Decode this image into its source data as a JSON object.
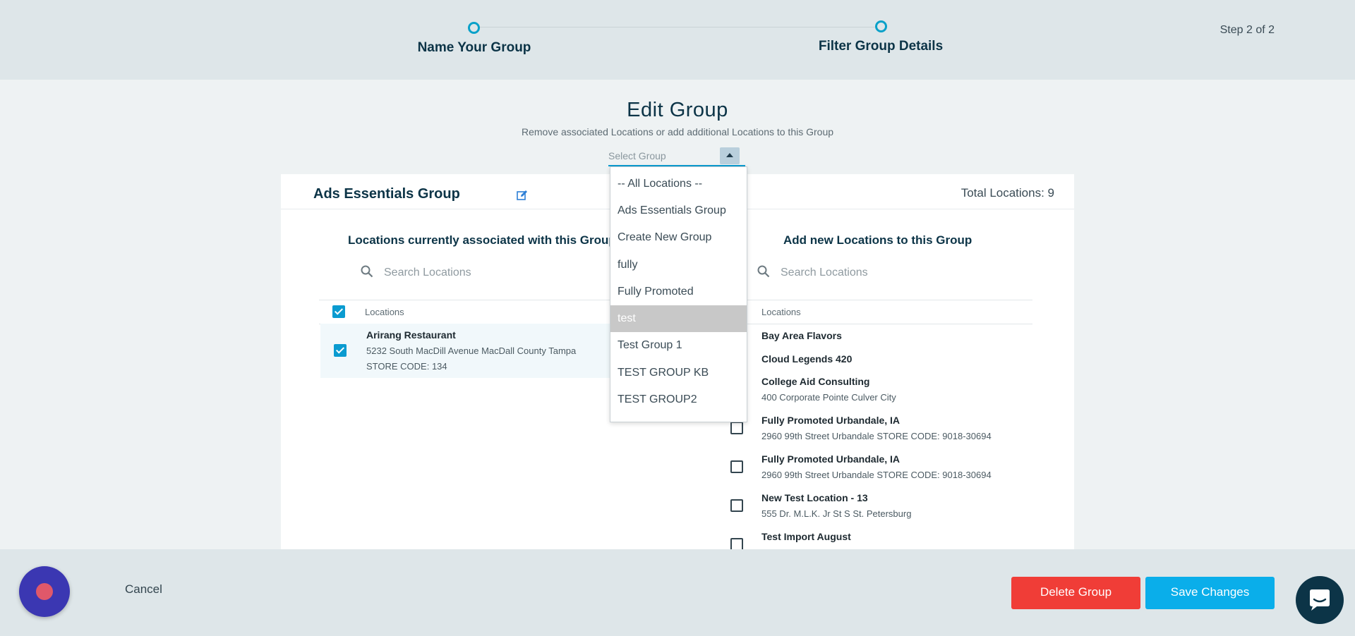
{
  "stepper": {
    "step1": "Name Your Group",
    "step2": "Filter Group Details",
    "counter": "Step 2 of 2"
  },
  "header": {
    "title": "Edit Group",
    "subtitle": "Remove associated Locations or add additional Locations to this Group"
  },
  "select": {
    "placeholder": "Select Group",
    "options": [
      "-- All Locations --",
      "Ads Essentials Group",
      "Create New Group",
      "fully",
      "Fully Promoted",
      "test",
      "Test Group 1",
      "TEST GROUP KB",
      "TEST GROUP2"
    ],
    "highlighted": "test"
  },
  "card": {
    "group_name": "Ads Essentials Group",
    "total_locations": "Total Locations: 9",
    "left": {
      "title": "Locations currently associated with this Group",
      "search_placeholder": "Search Locations",
      "column": "Locations",
      "rows": [
        {
          "name": "Arirang Restaurant",
          "address": "5232 South MacDill Avenue MacDall County Tampa",
          "store_code": "STORE CODE: 134",
          "checked": true
        }
      ]
    },
    "right": {
      "title": "Add new Locations to this Group",
      "search_placeholder": "Search Locations",
      "column": "Locations",
      "rows": [
        {
          "name": "Bay Area Flavors",
          "address": ""
        },
        {
          "name": "Cloud Legends 420",
          "address": ""
        },
        {
          "name": "College Aid Consulting",
          "address": "400 Corporate Pointe Culver City"
        },
        {
          "name": "Fully Promoted Urbandale, IA",
          "address": "2960 99th Street Urbandale STORE CODE: 9018-30694"
        },
        {
          "name": "Fully Promoted Urbandale, IA",
          "address": "2960 99th Street Urbandale STORE CODE: 9018-30694"
        },
        {
          "name": "New Test Location - 13",
          "address": "555 Dr. M.L.K. Jr St S St. Petersburg"
        },
        {
          "name": "Test Import August",
          "address": ""
        }
      ]
    }
  },
  "footer": {
    "cancel": "Cancel",
    "delete": "Delete Group",
    "save": "Save Changes"
  },
  "colors": {
    "accent": "#0a9bd0",
    "delete": "#f03d37",
    "save": "#0aaeea",
    "navy": "#0c3447"
  }
}
